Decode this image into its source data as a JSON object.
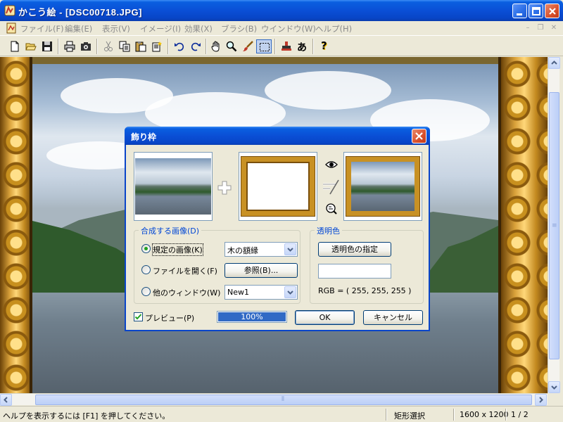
{
  "window": {
    "title": "かこう絵 - [DSC00718.JPG]"
  },
  "menu": {
    "items": [
      {
        "label": "ファイル(F)"
      },
      {
        "label": "編集(E)"
      },
      {
        "label": "表示(V)"
      },
      {
        "label": "イメージ(I)"
      },
      {
        "label": "効果(X)"
      },
      {
        "label": "ブラシ(B)"
      },
      {
        "label": "ウインドウ(W)"
      },
      {
        "label": "ヘルプ(H)"
      }
    ]
  },
  "toolbar": {
    "icons": [
      "new-icon",
      "open-icon",
      "save-icon",
      "print-icon",
      "camera-icon",
      "cut-icon",
      "copy-icon",
      "paste-icon",
      "paste-new-icon",
      "undo-icon",
      "redo-icon",
      "hand-icon",
      "zoom-icon",
      "brush-icon",
      "rect-select-icon",
      "stamp-icon",
      "text-icon",
      "help-icon"
    ],
    "text_tool_glyph": "あ",
    "help_glyph": "?"
  },
  "dialog": {
    "title": "飾り枠",
    "source_group_label": "合成する画像(D)",
    "radio_preset": "規定の画像(K)",
    "radio_file": "ファイルを開く(F)",
    "radio_window": "他のウィンドウ(W)",
    "preset_value": "木の額縁",
    "browse_button": "参照(B)...",
    "window_value": "New1",
    "transparent_group_label": "透明色",
    "transparent_button": "透明色の指定",
    "rgb_text": "RGB = ( 255, 255, 255 )",
    "preview_label": "プレビュー(P)",
    "preview_checked": true,
    "progress_text": "100%",
    "progress_value": 1.0,
    "ok_button": "OK",
    "cancel_button": "キャンセル"
  },
  "status": {
    "help_text": "ヘルプを表示するには [F1] を押してください。",
    "mode": "矩形選択",
    "dimensions": "1600 x 1200",
    "page": "1 / 2"
  },
  "colors": {
    "titlebar": "#0a4fd6",
    "group_label": "#0046d5",
    "progress": "#316ac5",
    "frame_gold": "#c89124"
  }
}
